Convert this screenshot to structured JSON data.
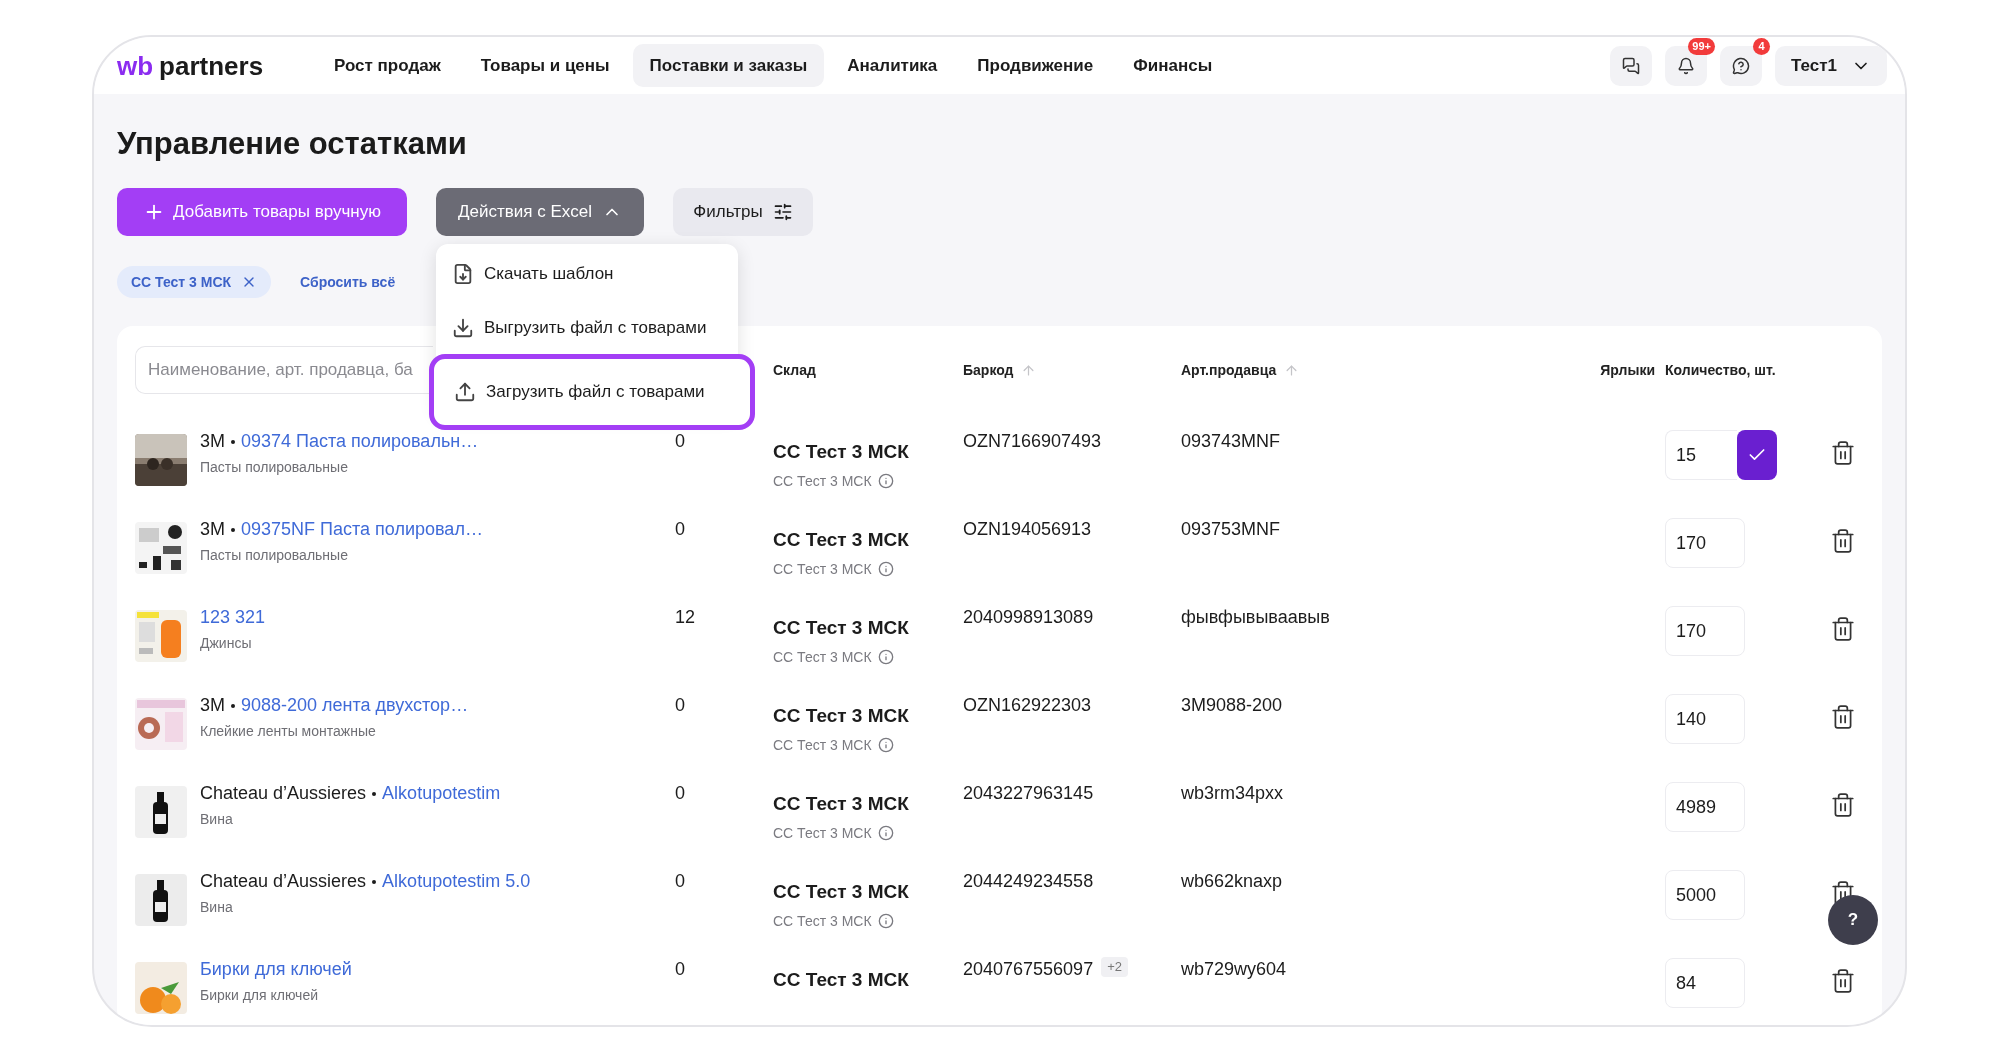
{
  "logo": {
    "prefix": "wb",
    "name": "partners"
  },
  "nav": [
    {
      "label": "Рост продаж",
      "selected": false
    },
    {
      "label": "Товары и цены",
      "selected": false
    },
    {
      "label": "Поставки и заказы",
      "selected": true
    },
    {
      "label": "Аналитика",
      "selected": false
    },
    {
      "label": "Продвижение",
      "selected": false
    },
    {
      "label": "Финансы",
      "selected": false
    }
  ],
  "header_actions": [
    {
      "kind": "chat"
    },
    {
      "kind": "bell",
      "badge": "99+"
    },
    {
      "kind": "help",
      "badge": "4"
    }
  ],
  "user": "Тест1",
  "title": "Управление остатками",
  "add_button": "Добавить товары вручную",
  "excel_button": {
    "label": "Действия с Excel",
    "expanded": true
  },
  "filters_button": "Фильтры",
  "excel_menu": [
    {
      "kind": "template",
      "label": "Скачать шаблон",
      "highlighted": false
    },
    {
      "kind": "download",
      "label": "Выгрузить файл с товарами",
      "highlighted": false
    },
    {
      "kind": "upload",
      "label": "Загрузить файл с товарами",
      "highlighted": true
    }
  ],
  "chips": [
    "СС Тест 3 МСК"
  ],
  "reset_all": "Сбросить всё",
  "search": {
    "placeholder": "Наименование, арт. продавца, ба"
  },
  "columns": [
    {
      "label": "Склад",
      "sortable": false
    },
    {
      "label": "Баркод",
      "sortable": true
    },
    {
      "label": "Арт.продавца",
      "sortable": true
    },
    {
      "label": "Ярлыки",
      "sortable": false
    },
    {
      "label": "Количество, шт.",
      "sortable": false
    }
  ],
  "rows": [
    {
      "brand": "3M",
      "name": "09374 Паста полировальн…",
      "category": "Пасты полировальные",
      "stock": "0",
      "warehouse": "СС Тест 3 МСК",
      "warehouse_sub": "СС Тест 3 МСК",
      "barcode": "OZN7166907493",
      "article": "093743MNF",
      "quantity": "15",
      "editing": true
    },
    {
      "brand": "3M",
      "name": "09375NF Паста полировал…",
      "category": "Пасты полировальные",
      "stock": "0",
      "warehouse": "СС Тест 3 МСК",
      "warehouse_sub": "СС Тест 3 МСК",
      "barcode": "OZN194056913",
      "article": "093753MNF",
      "quantity": "170",
      "editing": false
    },
    {
      "name": "123 321",
      "category": "Джинсы",
      "stock": "12",
      "warehouse": "СС Тест 3 МСК",
      "warehouse_sub": "СС Тест 3 МСК",
      "barcode": "2040998913089",
      "article": "фывфывываавыв",
      "quantity": "170",
      "editing": false
    },
    {
      "brand": "3M",
      "name": "9088-200 лента двухстор…",
      "category": "Клейкие ленты монтажные",
      "stock": "0",
      "warehouse": "СС Тест 3 МСК",
      "warehouse_sub": "СС Тест 3 МСК",
      "barcode": "OZN162922303",
      "article": "3M9088-200",
      "quantity": "140",
      "editing": false
    },
    {
      "brand": "Chateau d’Aussieres",
      "name": "Alkotupotestim",
      "category": "Вина",
      "stock": "0",
      "warehouse": "СС Тест 3 МСК",
      "warehouse_sub": "СС Тест 3 МСК",
      "barcode": "2043227963145",
      "article": "wb3rm34pxx",
      "quantity": "4989",
      "editing": false
    },
    {
      "brand": "Chateau d’Aussieres",
      "name": "Alkotupotestim 5.0",
      "category": "Вина",
      "stock": "0",
      "warehouse": "СС Тест 3 МСК",
      "warehouse_sub": "СС Тест 3 МСК",
      "barcode": "2044249234558",
      "article": "wb662knaxp",
      "quantity": "5000",
      "editing": false
    },
    {
      "name": "Бирки для ключей",
      "category": "Бирки для ключей",
      "stock": "0",
      "warehouse": "СС Тест 3 МСК",
      "barcode": "2040767556097",
      "barcode_extra": "+2",
      "article": "wb729wy604",
      "quantity": "84",
      "editing": false
    }
  ],
  "help_button": "?"
}
